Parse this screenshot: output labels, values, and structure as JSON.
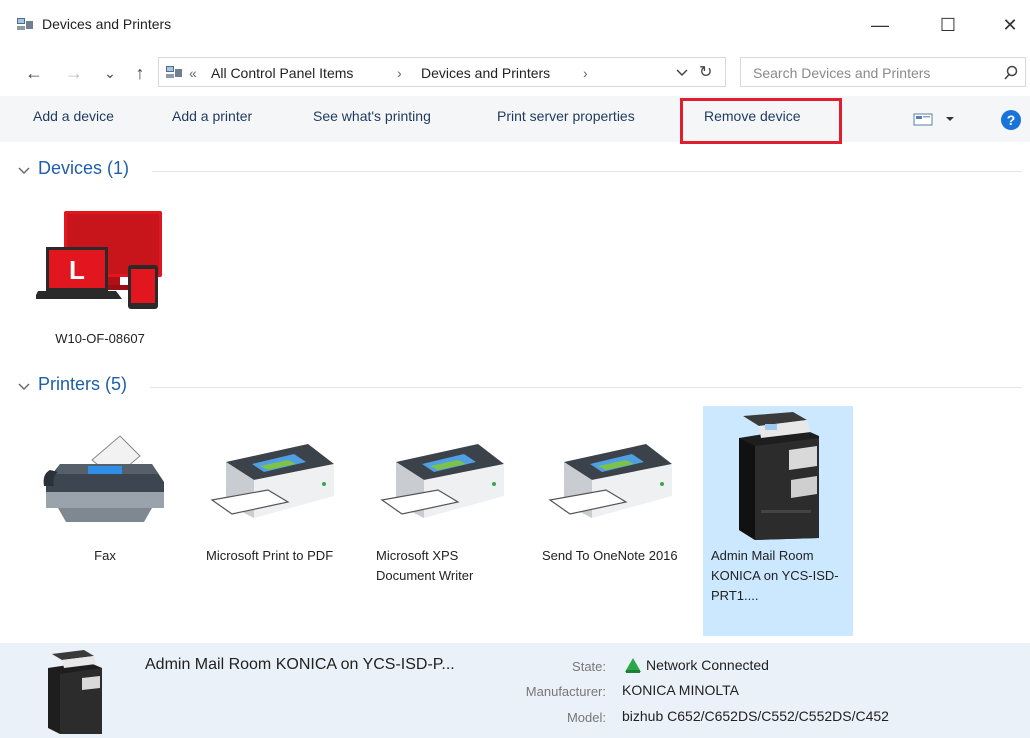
{
  "window": {
    "title": "Devices and Printers",
    "minimize_glyph": "—",
    "maximize_glyph": "☐",
    "close_glyph": "✕"
  },
  "nav": {
    "back_glyph": "←",
    "forward_glyph": "→",
    "recent_glyph": "⌄",
    "up_glyph": "↑",
    "refresh_glyph": "↻"
  },
  "address": {
    "overflow": "«",
    "crumbs": [
      "All Control Panel Items",
      "Devices and Printers"
    ],
    "separator": "›"
  },
  "search": {
    "placeholder": "Search Devices and Printers"
  },
  "toolbar": {
    "add_device": "Add a device",
    "add_printer": "Add a printer",
    "see_printing": "See what's printing",
    "print_server": "Print server properties",
    "remove_device": "Remove device"
  },
  "groups": {
    "devices": {
      "label": "Devices (1)"
    },
    "printers": {
      "label": "Printers (5)"
    }
  },
  "devices": [
    {
      "name": "W10-OF-08607",
      "icon": "computer-devices-icon"
    }
  ],
  "printers": [
    {
      "name": "Fax",
      "icon": "fax-icon"
    },
    {
      "name": "Microsoft Print to PDF",
      "icon": "printer-icon"
    },
    {
      "name": "Microsoft XPS Document Writer",
      "icon": "printer-icon"
    },
    {
      "name": "Send To OneNote 2016",
      "icon": "printer-icon"
    },
    {
      "name": "Admin Mail Room KONICA on YCS-ISD-PRT1....",
      "icon": "copier-icon",
      "selected": true
    }
  ],
  "details": {
    "title": "Admin Mail Room KONICA on YCS-ISD-P...",
    "state_label": "State:",
    "state_value": "Network Connected",
    "manufacturer_label": "Manufacturer:",
    "manufacturer_value": "KONICA MINOLTA",
    "model_label": "Model:",
    "model_value": "bizhub C652/C652DS/C552/C552DS/C452"
  },
  "colors": {
    "accent": "#1f5ea8",
    "highlight_border": "#e01e2d",
    "selection": "#cce8ff",
    "help": "#1a73d9",
    "status_green": "#2aa84a"
  }
}
